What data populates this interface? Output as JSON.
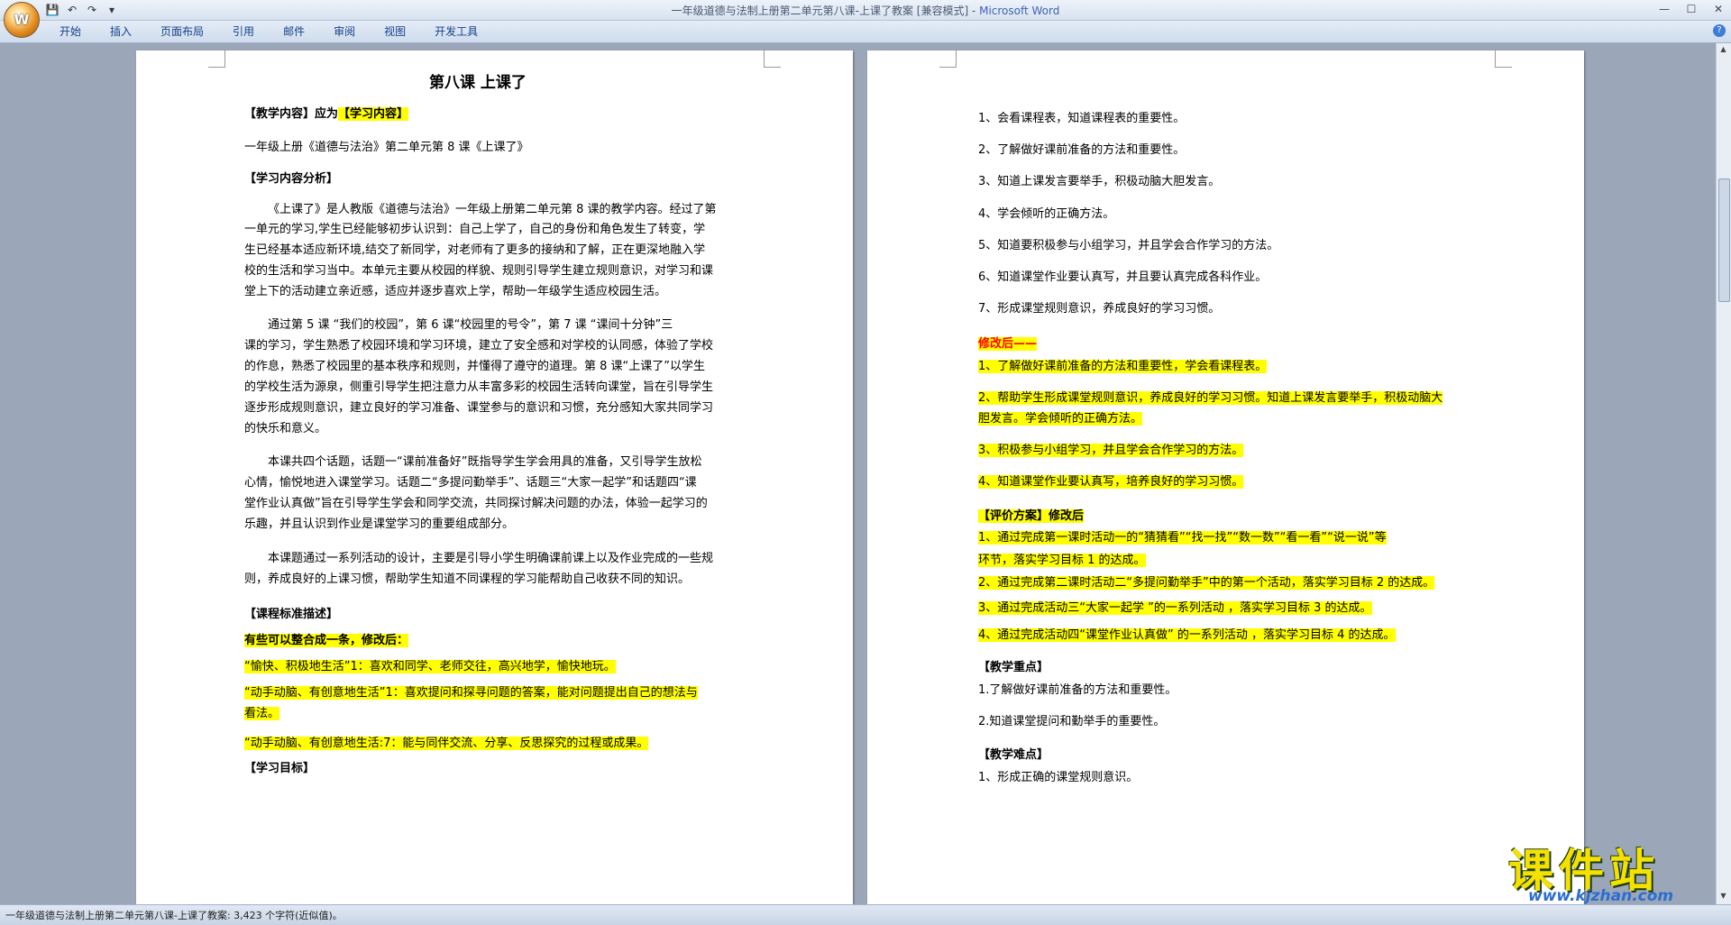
{
  "window": {
    "title_doc": "一年级道德与法制上册第二单元第八课-上课了教案 [兼容模式] - ",
    "title_app": "Microsoft Word"
  },
  "office_button": {
    "glyph": "W"
  },
  "quick_access": [
    {
      "name": "save-icon",
      "glyph": "💾"
    },
    {
      "name": "undo-icon",
      "glyph": "↶"
    },
    {
      "name": "redo-icon",
      "glyph": "↷"
    },
    {
      "name": "customize-qat-icon",
      "glyph": "▾"
    }
  ],
  "window_buttons": {
    "minimize": "—",
    "maximize": "☐",
    "close": "✕"
  },
  "ribbon_tabs": [
    "开始",
    "插入",
    "页面布局",
    "引用",
    "邮件",
    "审阅",
    "视图",
    "开发工具"
  ],
  "help_glyph": "?",
  "paragraph_mark": "↵",
  "page1": {
    "title": "第八课    上课了",
    "lines": [
      {
        "text": "【教学内容】应为",
        "bold": true
      },
      {
        "text": "一年级上册《道德与法治》第二单元第 8 课《上课了》"
      },
      {
        "text": "【学习内容分析】",
        "bold": true
      },
      {
        "text": "《上课了》是人教版《道德与法治》一年级上册第二单元第 8 课的教学内容。经过了第"
      },
      {
        "text": "一单元的学习,学生已经能够初步认识到：自己上学了，自己的身份和角色发生了转变，学"
      },
      {
        "text": "生已经基本适应新环境,结交了新同学，对老师有了更多的接纳和了解，正在更深地融入学"
      },
      {
        "text": "校的生活和学习当中。本单元主要从校园的样貌、规则引导学生建立规则意识，对学习和课"
      },
      {
        "text": "堂上下的活动建立亲近感，适应并逐步喜欢上学，帮助一年级学生适应校园生活。"
      },
      {
        "text": "通过第 5 课 “我们的校园”，第 6 课“校园里的号令”，第 7 课 “课间十分钟”三"
      },
      {
        "text": "课的学习，学生熟悉了校园环境和学习环境，建立了安全感和对学校的认同感，体验了学校"
      },
      {
        "text": "的作息，熟悉了校园里的基本秩序和规则，并懂得了遵守的道理。第 8 课“上课了”以学生"
      },
      {
        "text": "的学校生活为源泉，侧重引导学生把注意力从丰富多彩的校园生活转向课堂，旨在引导学生"
      },
      {
        "text": "逐步形成规则意识，建立良好的学习准备、课堂参与的意识和习惯，充分感知大家共同学习"
      },
      {
        "text": "的快乐和意义。"
      },
      {
        "text": "本课共四个话题，话题一“课前准备好”既指导学生学会用具的准备，又引导学生放松"
      },
      {
        "text": "心情，愉悦地进入课堂学习。话题二“多提问勤举手”、话题三“大家一起学”和话题四“课"
      },
      {
        "text": "堂作业认真做”旨在引导学生学会和同学交流，共同探讨解决问题的办法，体验一起学习的"
      },
      {
        "text": "乐趣，并且认识到作业是课堂学习的重要组成部分。"
      },
      {
        "text": "本课题通过一系列活动的设计，主要是引导小学生明确课前课上以及作业完成的一些规"
      },
      {
        "text": "则，养成良好的上课习惯，帮助学生知道不同课程的学习能帮助自己收获不同的知识。"
      },
      {
        "text": "【课程标准描述】",
        "bold": true
      },
      {
        "text": "有些可以整合成一条，修改后：",
        "bold": true,
        "hl": true
      },
      {
        "text": "“愉快、积极地生活”1：喜欢和同学、老师交往，高兴地学，愉快地玩。",
        "hl": true
      },
      {
        "text": "“动手动脑、有创意地生活”1：喜欢提问和探寻问题的答案，能对问题提出自己的想法与",
        "hl": true
      },
      {
        "text": "看法。",
        "hl": true
      },
      {
        "text": "“动手动脑、有创意地生活:7：能与同伴交流、分享、反思探究的过程或成果。",
        "hl": true
      },
      {
        "text": "【学习目标】",
        "bold": true
      }
    ],
    "highlight_inline": "【学习内容】"
  },
  "page2": {
    "lines": [
      {
        "text": "1、会看课程表，知道课程表的重要性。"
      },
      {
        "text": "2、了解做好课前准备的方法和重要性。"
      },
      {
        "text": "3、知道上课发言要举手，积极动脑大胆发言。"
      },
      {
        "text": "4、学会倾听的正确方法。"
      },
      {
        "text": "5、知道要积极参与小组学习，并且学会合作学习的方法。"
      },
      {
        "text": "6、知道课堂作业要认真写，并且要认真完成各科作业。"
      },
      {
        "text": "7、形成课堂规则意识，养成良好的学习习惯。"
      },
      {
        "text": "修改后——",
        "bold": true,
        "hl": true,
        "red": true
      },
      {
        "text": "1、了解做好课前准备的方法和重要性，学会看课程表。",
        "hl": true
      },
      {
        "text": "2、帮助学生形成课堂规则意识，养成良好的学习习惯。知道上课发言要举手，积极动脑大",
        "hl": true
      },
      {
        "text": "胆发言。学会倾听的正确方法。",
        "hl": true
      },
      {
        "text": "3、积极参与小组学习，并且学会合作学习的方法。",
        "hl": true
      },
      {
        "text": "4、知道课堂作业要认真写，培养良好的学习习惯。",
        "hl": true
      },
      {
        "text": "【评价方案】修改后",
        "bold": true,
        "hl": true
      },
      {
        "text": "1、通过完成第一课时活动一的“猜猜看”“找一找”“数一数”“看一看”“说一说”等",
        "hl": true
      },
      {
        "text": "环节，落实学习目标 1 的达成。",
        "hl": true
      },
      {
        "text": "2、通过完成第二课时活动二“多提问勤举手”中的第一个活动，落实学习目标 2 的达成。",
        "hl": true
      },
      {
        "text": "3、通过完成活动三“大家一起学 ”的一系列活动 ，落实学习目标 3 的达成。",
        "hl": true
      },
      {
        "text": "4、通过完成活动四“课堂作业认真做” 的一系列活动 ，落实学习目标 4 的达成。",
        "hl": true
      },
      {
        "text": "【教学重点】",
        "bold": true
      },
      {
        "text": "1.了解做好课前准备的方法和重要性。"
      },
      {
        "text": "2.知道课堂提问和勤举手的重要性。"
      },
      {
        "text": "【教学难点】",
        "bold": true
      },
      {
        "text": "1、形成正确的课堂规则意识。"
      }
    ]
  },
  "status_bar": {
    "text": "一年级道德与法制上册第二单元第八课-上课了教案: 3,423 个字符(近似值)。"
  },
  "watermark": {
    "main": "课件站",
    "url": "www.kjzhan.com"
  },
  "colors": {
    "highlight": "#ffff00",
    "red_text": "#ff0000",
    "app_blue": "#3f63b5"
  }
}
